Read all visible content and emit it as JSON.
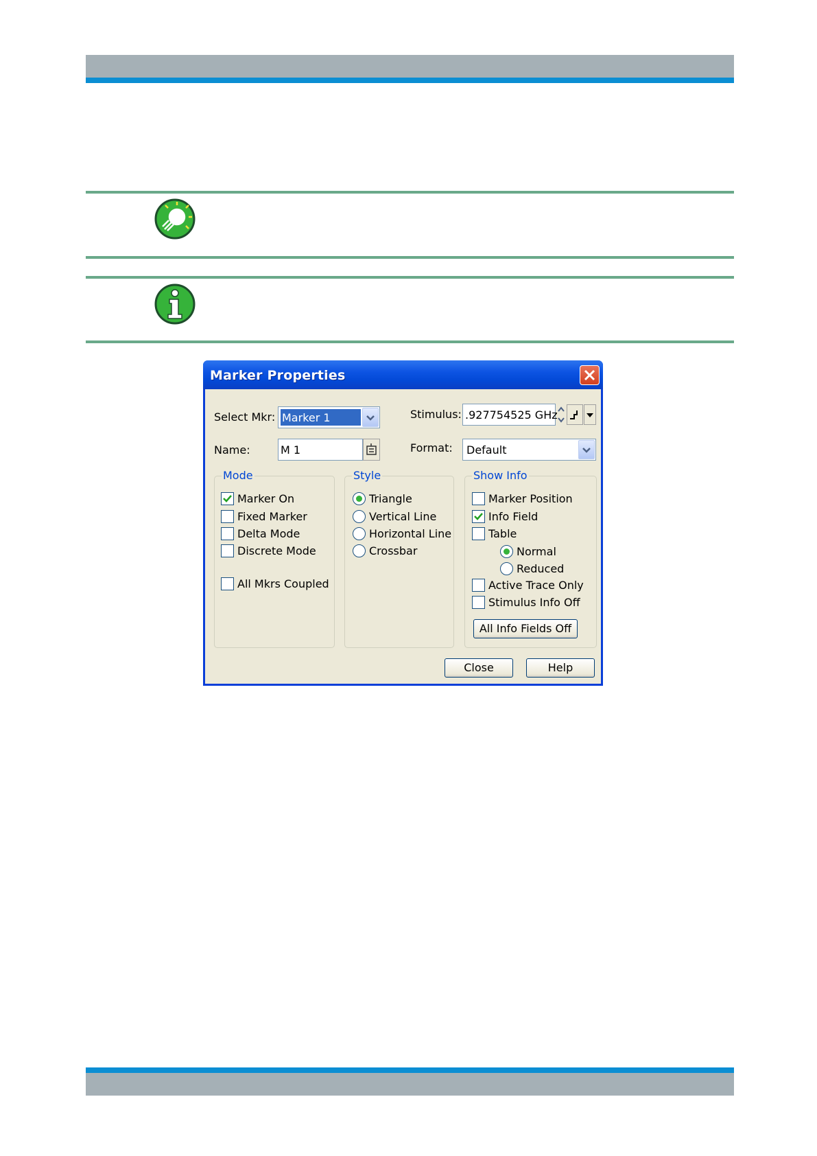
{
  "dialog": {
    "title": "Marker Properties",
    "select_mkr_label": "Select Mkr:",
    "select_mkr_value": "Marker 1",
    "stimulus_label": "Stimulus:",
    "stimulus_value": ".927754525 GHz",
    "name_label": "Name:",
    "name_value": "M 1",
    "format_label": "Format:",
    "format_value": "Default",
    "mode": {
      "label": "Mode",
      "items": [
        {
          "label": "Marker On",
          "checked": true
        },
        {
          "label": "Fixed Marker",
          "checked": false
        },
        {
          "label": "Delta Mode",
          "checked": false
        },
        {
          "label": "Discrete Mode",
          "checked": false
        }
      ],
      "coupled": {
        "label": "All Mkrs Coupled",
        "checked": false
      }
    },
    "style": {
      "label": "Style",
      "items": [
        {
          "label": "Triangle",
          "selected": true
        },
        {
          "label": "Vertical Line",
          "selected": false
        },
        {
          "label": "Horizontal Line",
          "selected": false
        },
        {
          "label": "Crossbar",
          "selected": false
        }
      ]
    },
    "show_info": {
      "label": "Show Info",
      "items": [
        {
          "label": "Marker Position",
          "checked": false
        },
        {
          "label": "Info Field",
          "checked": true
        },
        {
          "label": "Table",
          "checked": false
        }
      ],
      "table_modes": [
        {
          "label": "Normal",
          "selected": true
        },
        {
          "label": "Reduced",
          "selected": false
        }
      ],
      "extra": [
        {
          "label": "Active Trace Only",
          "checked": false
        },
        {
          "label": "Stimulus Info Off",
          "checked": false
        }
      ],
      "all_off_label": "All Info Fields Off"
    },
    "close_label": "Close",
    "help_label": "Help"
  },
  "colors": {
    "header_gray": "#a5b0b6",
    "header_blue": "#0b8ed3",
    "rule_green": "#6aa98a",
    "accent_green": "#36b33a",
    "group_label_blue": "#0046d5"
  },
  "icons": {
    "tip": "lightbulb-icon",
    "note": "info-icon"
  }
}
